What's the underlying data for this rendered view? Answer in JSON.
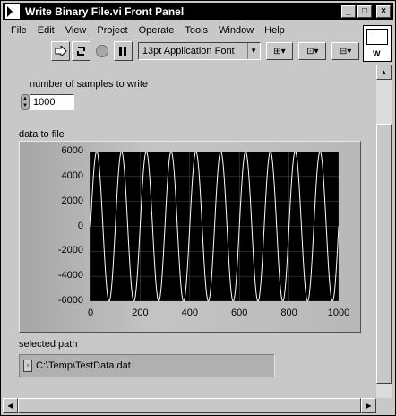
{
  "window": {
    "title": "Write Binary File.vi Front Panel"
  },
  "menu": [
    "File",
    "Edit",
    "View",
    "Project",
    "Operate",
    "Tools",
    "Window",
    "Help"
  ],
  "toolbar": {
    "font_select": "13pt Application Font"
  },
  "vi_icon": {
    "letter": "W"
  },
  "controls": {
    "samples_label": "number of samples to write",
    "samples_value": "1000",
    "graph_label": "data to file",
    "path_label": "selected path",
    "path_value": "C:\\Temp\\TestData.dat"
  },
  "chart_data": {
    "type": "line",
    "x_ticks": [
      "0",
      "200",
      "400",
      "600",
      "800",
      "1000"
    ],
    "y_ticks": [
      "6000",
      "4000",
      "2000",
      "0",
      "-2000",
      "-4000",
      "-6000"
    ],
    "xlim": [
      0,
      1000
    ],
    "ylim": [
      -6000,
      6000
    ],
    "grid": true,
    "series": [
      {
        "amplitude": 6000,
        "cycles": 10,
        "points": 1000,
        "color": "#ffffff"
      }
    ]
  },
  "colors": {
    "plot_bg": "#000000",
    "trace": "#ffffff",
    "grid": "#505050"
  }
}
